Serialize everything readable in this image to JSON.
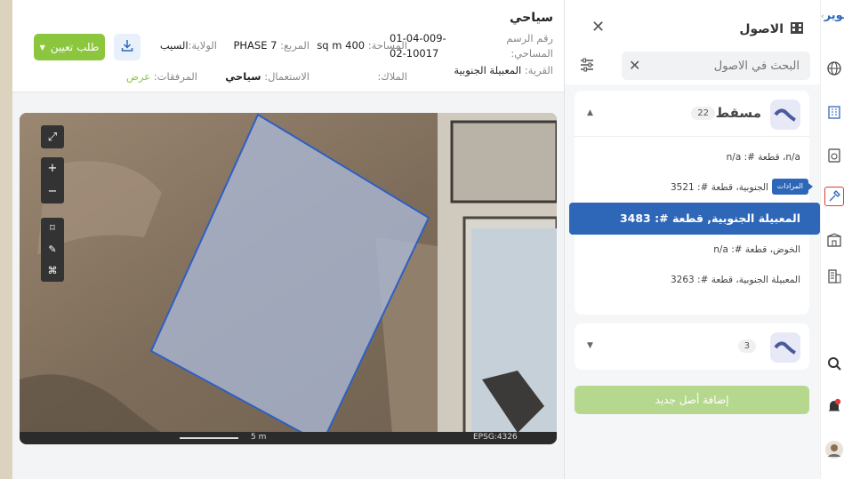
{
  "info": {
    "title": "سياحي",
    "deed_label": "رقم الرسم المساحي:",
    "deed_value": "01-04-009-02-10017",
    "area_label": "المساحة:",
    "area_value": "400 sq m",
    "block_label": "المربع:",
    "block_value": "PHASE 7",
    "state_label": "الولاية:",
    "state_value": "السيب",
    "village_label": "القرية:",
    "village_value": "المعبيلة الجنوبية",
    "owners_label": "الملاك:",
    "owners_value": "",
    "usage_label": "الاستعمال:",
    "usage_value": "سياحي",
    "attachments_label": "المرفقات:",
    "attachments_link": "عرض",
    "request_button": "طلب تعيين",
    "download_icon": "download-icon"
  },
  "map": {
    "scale_label": "5 m",
    "projection": "EPSG:4326",
    "tools": [
      "expand-icon",
      "zoom-in-icon",
      "zoom-out-icon",
      "bounding-box-icon",
      "draw-icon",
      "measure-icon"
    ],
    "zoom_in": "+",
    "zoom_out": "−"
  },
  "panel": {
    "title": "الاصول",
    "search_placeholder": "البحث في الاصول",
    "categories": [
      {
        "name": "مسقط",
        "count": "22",
        "expanded": true,
        "items": [
          {
            "label": "n/a، قطعة #: n/a",
            "active": false
          },
          {
            "label": "المعبيلة الجنوبية، قطعة #: 3521",
            "active": false,
            "tooltip": "المرادات"
          },
          {
            "label": "المعبيلة الجنوبية, قطعة #: 3483",
            "active": true
          },
          {
            "label": "الخوض، قطعة #: n/a",
            "active": false
          },
          {
            "label": "المعبيلة الجنوبية، قطعة #: 3263",
            "active": false
          }
        ]
      },
      {
        "name": "",
        "count": "3",
        "expanded": false,
        "items": []
      }
    ],
    "add_button": "إضافة أصل جديد"
  },
  "rail": {
    "brand": "تطوير",
    "icons": [
      "globe-icon",
      "building-icon",
      "certificate-icon",
      "assets-hammer-icon",
      "property-icon",
      "tower-icon",
      "search-icon",
      "bell-icon",
      "user-avatar"
    ],
    "notification_badge": ""
  },
  "colors": {
    "primary": "#2f67b8",
    "green": "#8cc63f",
    "selected_outline": "#e03b3b"
  }
}
